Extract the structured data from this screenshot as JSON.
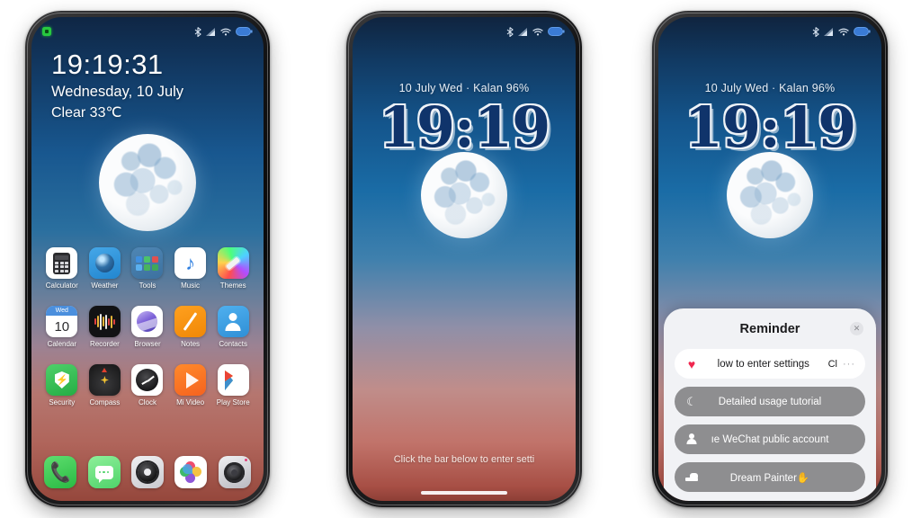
{
  "scene": {
    "background_color": "#ffffff",
    "phone_count": 3
  },
  "phone1": {
    "name": "home-screen",
    "status_bar": {
      "left_badge": "camera-privacy-indicator",
      "icons": [
        "bluetooth-icon",
        "signal-icon",
        "wifi-icon",
        "battery-icon"
      ]
    },
    "clock_widget": {
      "time": "19:19:31",
      "date": "Wednesday, 10 July",
      "weather": "Clear 33℃"
    },
    "apps": [
      {
        "label": "Calculator",
        "icon": "calculator-icon"
      },
      {
        "label": "Weather",
        "icon": "weather-icon"
      },
      {
        "label": "Tools",
        "icon": "tools-folder-icon"
      },
      {
        "label": "Music",
        "icon": "music-icon"
      },
      {
        "label": "Themes",
        "icon": "themes-icon"
      },
      {
        "label": "Calendar",
        "icon": "calendar-icon",
        "day_name": "Wed",
        "day_number": "10"
      },
      {
        "label": "Recorder",
        "icon": "recorder-icon"
      },
      {
        "label": "Browser",
        "icon": "browser-icon"
      },
      {
        "label": "Notes",
        "icon": "notes-icon"
      },
      {
        "label": "Contacts",
        "icon": "contacts-icon"
      },
      {
        "label": "Security",
        "icon": "security-icon"
      },
      {
        "label": "Compass",
        "icon": "compass-icon"
      },
      {
        "label": "Clock",
        "icon": "clock-icon"
      },
      {
        "label": "Mi Video",
        "icon": "mi-video-icon"
      },
      {
        "label": "Play Store",
        "icon": "play-store-icon"
      }
    ],
    "dock": [
      {
        "label": "Phone",
        "icon": "phone-icon"
      },
      {
        "label": "Messages",
        "icon": "messages-icon"
      },
      {
        "label": "Settings",
        "icon": "settings-gear-icon"
      },
      {
        "label": "Gallery",
        "icon": "gallery-icon"
      },
      {
        "label": "Camera",
        "icon": "camera-icon"
      }
    ]
  },
  "phone2": {
    "name": "lock-screen",
    "status_bar": {
      "icons": [
        "bluetooth-icon",
        "signal-icon",
        "wifi-icon",
        "battery-icon"
      ]
    },
    "meta_line": "10 July Wed · Kalan 96%",
    "big_time": "19:19",
    "hint": "Click the bar below to enter setti",
    "home_indicator": "home-bar"
  },
  "phone3": {
    "name": "lock-screen-with-reminder",
    "status_bar": {
      "icons": [
        "bluetooth-icon",
        "signal-icon",
        "wifi-icon",
        "battery-icon"
      ]
    },
    "meta_line": "10 July Wed · Kalan 96%",
    "big_time": "19:19",
    "reminder": {
      "title": "Reminder",
      "close_label": "✕",
      "rows": [
        {
          "icon": "heart-icon",
          "label": "low to enter settings",
          "tail_text": "Cl",
          "tail_dots": "···",
          "style": "white"
        },
        {
          "icon": "moon-icon",
          "label": "Detailed usage tutorial",
          "style": "gray"
        },
        {
          "icon": "person-icon",
          "label": "ıe WeChat public account",
          "style": "gray"
        },
        {
          "icon": "bed-icon",
          "label": "Dream Painter✋",
          "style": "gray"
        }
      ]
    }
  },
  "colors": {
    "sky_top": "#10243f",
    "sky_mid": "#1a6ca6",
    "sky_bottom": "#8d3f36",
    "accent_heart": "#f0264e",
    "sheet_bg": "#f1f2f5",
    "row_gray": "#8e8e90"
  }
}
